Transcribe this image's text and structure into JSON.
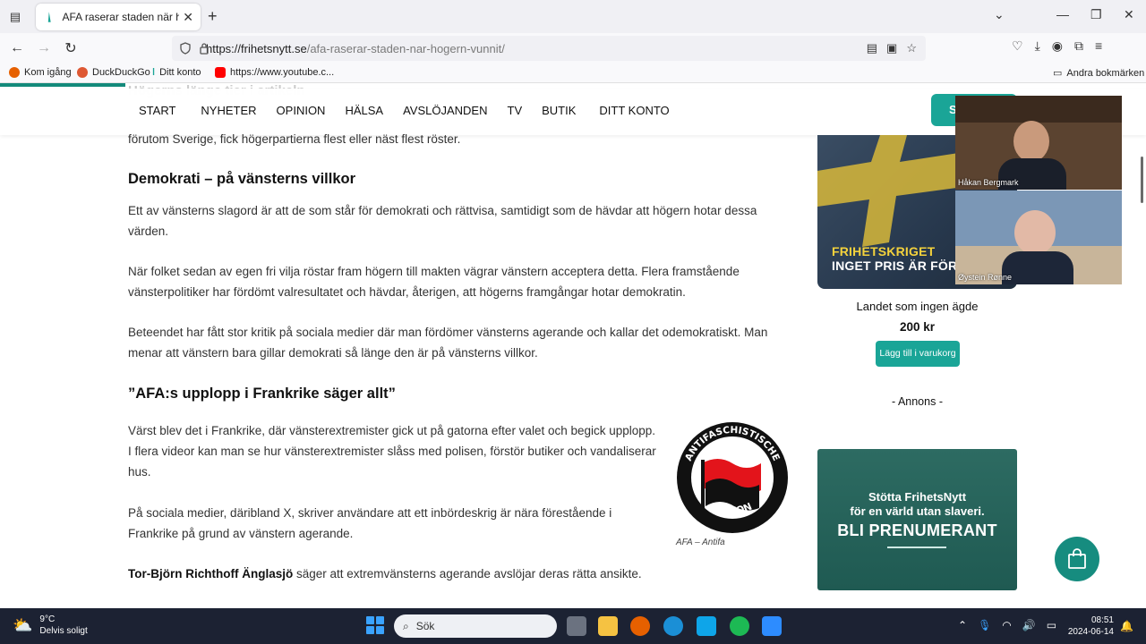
{
  "browser": {
    "tab_title": "AFA raserar staden när högern",
    "new_tab": "+",
    "url_host": "https://frihetsnytt.se",
    "url_path": "/afa-raserar-staden-nar-hogern-vunnit/",
    "bookmarks": [
      "Kom igång",
      "DuckDuckGo",
      "Ditt konto",
      "https://www.youtube.c..."
    ],
    "other_bookmarks": "Andra bokmärken"
  },
  "site_nav": {
    "items": [
      "START",
      "NYHETER",
      "OPINION",
      "HÄLSA",
      "AVSLÖJANDEN",
      "TV",
      "BUTIK",
      "DITT KONTO"
    ],
    "subscribe_label": "S"
  },
  "article": {
    "ghost_heading": "Högerns länge tier i artikeln",
    "p0": "förutom Sverige, fick högerpartierna flest eller näst flest röster.",
    "h_democracy": "Demokrati – på vänsterns villkor",
    "p1": "Ett av vänsterns slagord är att de som står för demokrati och rättvisa, samtidigt som de hävdar att högern hotar dessa värden.",
    "p2": "När folket sedan av egen fri vilja röstar fram högern till makten vägrar vänstern acceptera detta. Flera framstående vänsterpolitiker har fördömt valresultatet och hävdar, återigen, att högerns framgångar hotar demokratin.",
    "p3": "Beteendet har fått stor kritik på sociala medier där man fördömer vänsterns agerande och kallar det odemokratiskt. Man menar att vänstern bara gillar demokrati så länge den är på vänsterns villkor.",
    "h_afa": "”AFA:s upplopp i Frankrike säger allt”",
    "p4": "Värst blev det i Frankrike, där vänsterextremister gick ut på gatorna efter valet och begick upplopp. I flera videor kan man se hur vänsterextremister slåss med polisen, förstör butiker och vandaliserar hus.",
    "p5": "På sociala medier, däribland X, skriver användare att ett inbördeskrig är nära förestående i Frankrike på grund av vänstern agerande.",
    "p6_name": "Tor-Björn Richthoff Änglasjö",
    "p6_rest": " säger att extremvänsterns agerande avslöjar deras rätta ansikte.",
    "logo_text_top": "ANTIFASCHISTISCHE",
    "logo_text_bottom": "AKTION",
    "logo_caption": "AFA – Antifa"
  },
  "sidebar": {
    "book_title_line1": "FRIHETSKRIGET",
    "book_title_line2": "INGET PRIS ÄR FÖR HÖGT",
    "product_name": "Landet som ingen ägde",
    "price": "200 kr",
    "cart_button": "Lägg till i varukorg",
    "annons": "- Annons -",
    "ad_line1": "Stötta FrihetsNytt",
    "ad_line2": "för en värld utan slaveri.",
    "ad_line3": "BLI PRENUMERANT"
  },
  "video": {
    "participant1": "Håkan Bergmark",
    "participant2": "Øystein Rønne"
  },
  "taskbar": {
    "temp": "9°C",
    "weather": "Delvis soligt",
    "search": "Sök",
    "time": "08:51",
    "date": "2024-06-14"
  },
  "colors": {
    "accent": "#1aa597",
    "progress": "#138a7b",
    "taskbar": "#1c2233"
  }
}
